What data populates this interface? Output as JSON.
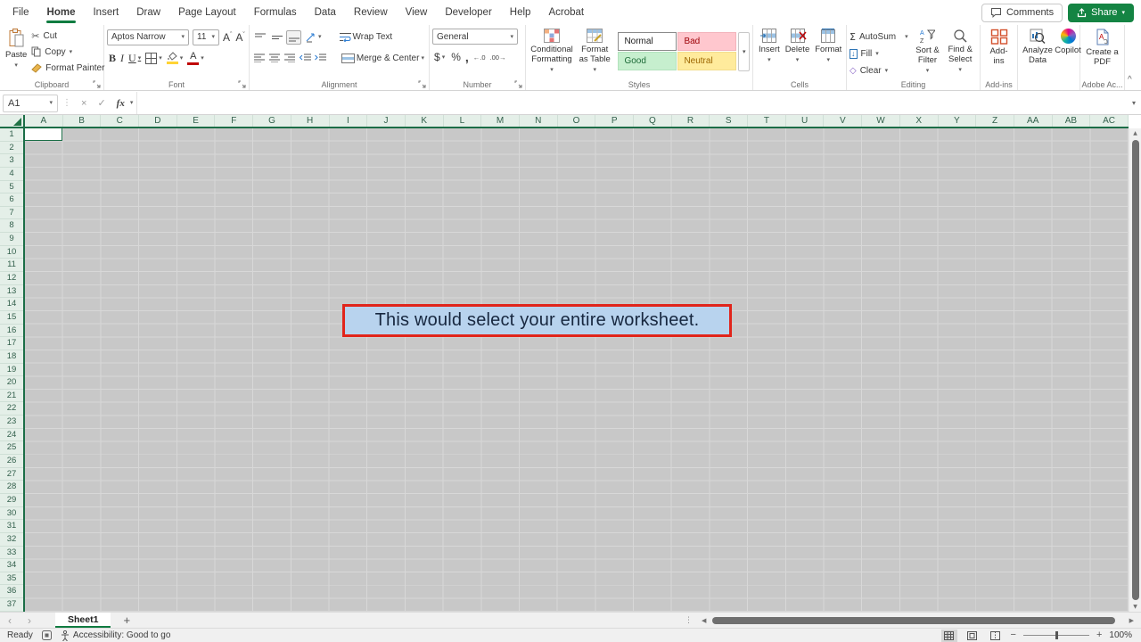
{
  "menubar": {
    "tabs": [
      "File",
      "Home",
      "Insert",
      "Draw",
      "Page Layout",
      "Formulas",
      "Data",
      "Review",
      "View",
      "Developer",
      "Help",
      "Acrobat"
    ],
    "active_tab": "Home",
    "comments": "Comments",
    "share": "Share"
  },
  "ribbon": {
    "clipboard": {
      "group": "Clipboard",
      "paste": "Paste",
      "cut": "Cut",
      "copy": "Copy",
      "format_painter": "Format Painter"
    },
    "font": {
      "group": "Font",
      "name": "Aptos Narrow",
      "size": "11",
      "bold": "B",
      "italic": "I",
      "underline": "U",
      "grow": "A",
      "shrink": "A",
      "color_letter": "A",
      "fill_color": "#ffd335",
      "font_color": "#c00000"
    },
    "alignment": {
      "group": "Alignment",
      "wrap": "Wrap Text",
      "merge": "Merge & Center"
    },
    "number": {
      "group": "Number",
      "format": "General",
      "currency": "$",
      "percent": "%",
      "comma": ",",
      "inc_dec": "←.0",
      "dec_dec": ".00→"
    },
    "styles": {
      "group": "Styles",
      "conditional": "Conditional Formatting",
      "format_table": "Format as Table",
      "gallery": [
        {
          "name": "Normal",
          "bg": "#ffffff",
          "fg": "#212121",
          "border": "#8a8a8a"
        },
        {
          "name": "Bad",
          "bg": "#ffc7ce",
          "fg": "#9c0006",
          "border": "#f3b3bb"
        },
        {
          "name": "Good",
          "bg": "#c6efce",
          "fg": "#1d6b38",
          "border": "#b2e2bd"
        },
        {
          "name": "Neutral",
          "bg": "#ffeb9c",
          "fg": "#9c6500",
          "border": "#f2dd8d"
        }
      ]
    },
    "cells": {
      "group": "Cells",
      "insert": "Insert",
      "delete": "Delete",
      "format": "Format"
    },
    "editing": {
      "group": "Editing",
      "autosum": "AutoSum",
      "fill": "Fill",
      "clear": "Clear",
      "sort_filter": "Sort & Filter",
      "find_select": "Find & Select"
    },
    "addins": {
      "group": "Add-ins",
      "button": "Add-ins"
    },
    "ai": {
      "analyze": "Analyze Data",
      "copilot": "Copilot"
    },
    "adobe": {
      "group": "Adobe Ac...",
      "create_pdf": "Create a PDF"
    }
  },
  "formula_bar": {
    "name_box": "A1",
    "formula": ""
  },
  "grid": {
    "columns": [
      "A",
      "B",
      "C",
      "D",
      "E",
      "F",
      "G",
      "H",
      "I",
      "J",
      "K",
      "L",
      "M",
      "N",
      "O",
      "P",
      "Q",
      "R",
      "S",
      "T",
      "U",
      "V",
      "W",
      "X",
      "Y",
      "Z",
      "AA",
      "AB",
      "AC"
    ],
    "row_count": 37,
    "active_cell": "A1",
    "cell_bg": "#c8c8c8",
    "gridline_color": "#d8d8d8"
  },
  "callout": {
    "text": "This would select your entire worksheet.",
    "bg": "#b8d3ee",
    "border": "#e1251b",
    "text_color": "#17273f"
  },
  "sheet_bar": {
    "active_tab": "Sheet1"
  },
  "status_bar": {
    "mode": "Ready",
    "accessibility": "Accessibility: Good to go",
    "zoom_level": "100%"
  },
  "icons": {
    "caret": "▾",
    "collapse": "^",
    "close": "×",
    "check": "✓",
    "fx": "fx",
    "dots": "⋮",
    "left": "◀",
    "right": "▶",
    "up": "▲",
    "down": "▼",
    "nav_left": "‹",
    "nav_right": "›",
    "plus": "+",
    "minus": "−",
    "sigma": "Σ",
    "scissors": "✂",
    "fill_arrow": "↓",
    "clear_diamond": "◇",
    "grow_caret": "ˆ",
    "shrink_caret": "ˇ"
  }
}
